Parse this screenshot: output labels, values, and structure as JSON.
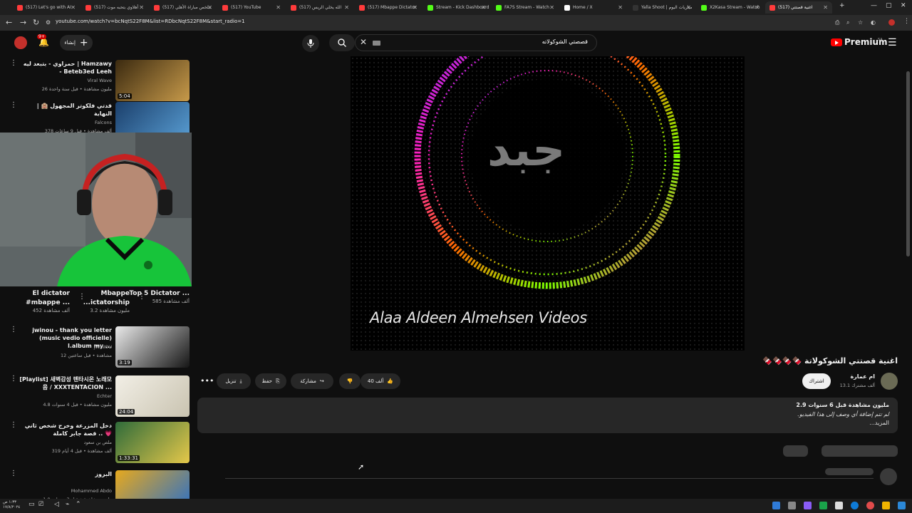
{
  "browser": {
    "tabs": [
      {
        "label": "(517) Let's go with AI",
        "color": "#ff3b3b"
      },
      {
        "label": "(517) أهلاوي بتحبه موت",
        "color": "#ff3b3b"
      },
      {
        "label": "(517) ملخص مباراة الأهلي",
        "color": "#ff3b3b"
      },
      {
        "label": "(517) YouTube",
        "color": "#ff3b3b"
      },
      {
        "label": "(517) الله يخلي الريس",
        "color": "#ff3b3b"
      },
      {
        "label": "(517) Mbappe Dictator",
        "color": "#ff3b3b"
      },
      {
        "label": "Stream - Kick Dashboard",
        "color": "#53fc18"
      },
      {
        "label": "FA7S Stream - Watch",
        "color": "#53fc18"
      },
      {
        "label": "Home / X",
        "color": "#ffffff"
      },
      {
        "label": "Yalla Shoot | مباريات اليوم",
        "color": "#333333"
      },
      {
        "label": "X2Kasa Stream - Watch",
        "color": "#53fc18"
      },
      {
        "label": "(517) اغنية قصتتي",
        "color": "#ff3b3b"
      }
    ],
    "url": "youtube.com/watch?v=bcNqtS22F8M&list=RDbcNqtS22F8M&start_radio=1"
  },
  "yt": {
    "create_label": "إنشاء",
    "notif_count": "9+",
    "search_query": "قصصتي الشوكولاته",
    "premium_label": "Premium",
    "premium_sup": "SA"
  },
  "sidebar": {
    "recs": [
      {
        "title": "حمزاوي - بتبعد ليه | Hamzawy - Beteb3ed Leeh",
        "channel": "Viral Wave",
        "meta": "26 مليون مشاهدة • قبل سنة واحدة",
        "duration": "5:04"
      },
      {
        "title": "قدتي فلكوتر المجهول 🏨 | النهاية",
        "channel": "Falcons",
        "meta": "378 ألف مشاهدة • قبل 9 ساعات",
        "duration": ""
      },
      {
        "title": "jwinou - thank you letter (music vedio officielle) l.album my ...",
        "channel": "JWINOU",
        "meta": "12 مشاهدة • قبل ساعتين",
        "duration": "3:19"
      },
      {
        "title": "[Playlist] 새벽감성 텐타시온 노래모음 / XXXTENTACION ...",
        "channel": "Echter",
        "meta": "4.8 مليون مشاهدة • قبل 4 سنوات",
        "duration": "24:04"
      },
      {
        "title": "دخل المزرعة وخرج شخص ثاني .. قصة جابر كاملة 💗",
        "channel": "ملص بن سعود",
        "meta": "319 ألف مشاهدة • قبل 4 أيام",
        "duration": "1:33:31"
      },
      {
        "title": "البروز",
        "channel": "Mohammed Abdo",
        "meta": "1.9 مليون مشاهدة • قبل 3 سنوات",
        "duration": ""
      }
    ],
    "shorts": [
      {
        "title": "Top 5 Dictator ...",
        "views": "585 ألف مشاهدة"
      },
      {
        "title": "Mbappe ...ictatorship",
        "views": "3.2 مليون مشاهدة"
      },
      {
        "title": "El dictator #mbappe ...",
        "views": "452 ألف مشاهدة"
      }
    ]
  },
  "player": {
    "logo_text": "جبد",
    "watermark": "Alaa Aldeen Almehsen Videos"
  },
  "video": {
    "title": "اغنية قصتتي الشوكولاتة 🍫🍫🍫🍫",
    "channel_name": "ام عمارة",
    "channel_subs": "13.1 ألف مشترك",
    "subscribe_label": "اشتراك",
    "like_count": "40 ألف",
    "share_label": "مشاركة",
    "save_label": "حفظ",
    "download_label": "تنزيل",
    "views_date": "2.9 مليون مشاهدة قبل 6 سنوات",
    "description": "لم تتم إضافة أي وصف إلى هذا الفيديو.",
    "more_label": "...المزيد"
  },
  "taskbar": {
    "time": "١:٣٣ ص",
    "date": "١٧/٨/٢٠٢٤"
  }
}
